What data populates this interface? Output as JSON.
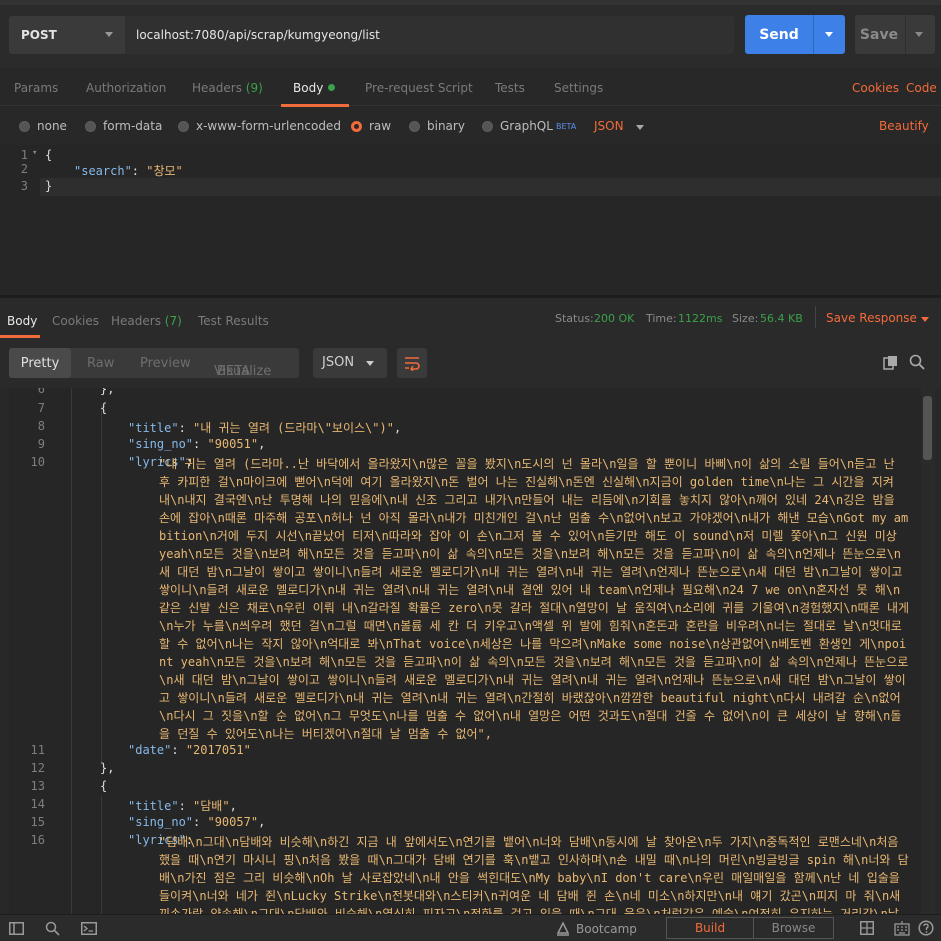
{
  "request": {
    "method": "POST",
    "url": "localhost:7080/api/scrap/kumgyeong/list",
    "send_label": "Send",
    "save_label": "Save"
  },
  "request_tabs": {
    "params": "Params",
    "authorization": "Authorization",
    "headers": "Headers",
    "headers_count": "(9)",
    "body": "Body",
    "pre_request": "Pre-request Script",
    "tests": "Tests",
    "settings": "Settings",
    "cookies": "Cookies",
    "code": "Code"
  },
  "body_options": {
    "none": "none",
    "form_data": "form-data",
    "urlencoded": "x-www-form-urlencoded",
    "raw": "raw",
    "binary": "binary",
    "graphql": "GraphQL",
    "beta": "BETA",
    "format": "JSON",
    "beautify": "Beautify"
  },
  "request_body": {
    "line_numbers": [
      "1",
      "2",
      "3"
    ],
    "open": "{",
    "key": "\"search\"",
    "colon": ": ",
    "value": "\"창모\"",
    "close": "}"
  },
  "response_tabs": {
    "body": "Body",
    "cookies": "Cookies",
    "headers": "Headers",
    "headers_count": "(7)",
    "test_results": "Test Results",
    "status_label": "Status:",
    "status_value": "200 OK",
    "time_label": "Time:",
    "time_value": "1122ms",
    "size_label": "Size:",
    "size_value": "56.4 KB",
    "save_response": "Save Response"
  },
  "view_bar": {
    "pretty": "Pretty",
    "raw": "Raw",
    "preview": "Preview",
    "visualize": "Visualize",
    "beta": "BETA",
    "format": "JSON"
  },
  "response": {
    "ln": [
      "6",
      "7",
      "8",
      "9",
      "10",
      "11",
      "12",
      "13",
      "14",
      "15",
      "16"
    ],
    "line6": "},",
    "line7": "{",
    "title1_key": "\"title\"",
    "title1_val": "\"내 귀는 열려 (드라마\\\"보이스\\\")\"",
    "sing1_key": "\"sing_no\"",
    "sing1_val": "\"90051\"",
    "lyrics_key": "\"lyrics\"",
    "lyrics1": "\"내 귀는 열려 (드라마..난 바닥에서 올라왔지\\n많은 꼴을 봤지\\n도시의 넌 몰라\\n일을 할 뿐이니 바삐\\n이 삶의 소릴 들어\\n듣고 난 후 카피한 걸\\n마이크에 뻗어\\n덕에 여기 올라왔지\\n돈 벌어 나는 진실해\\n돈엔 신실해\\n지금이 golden time\\n나는 그 시간을 지켜 내\\n내지 결국엔\\n난 투명해 나의 믿음에\\n내 신조 그리고 내가\\n만들어 내는 리듬에\\n기회를 놓치지 않아\\n깨어 있네 24\\n깅은 밤을 손에 잡아\\n때론 마주해 공포\\n허나 넌 아직 몰라\\n내가 미친개인 걸\\n난 멈출 수\\n없어\\n보고 가야겠어\\n내가 해낸 모습\\nGot my ambition\\n거에 두지 시선\\n끝났어 티저\\n따라와 잡아 이 손\\n그저 볼 수 있어\\n듣기만 해도 이 sound\\n저 미렐 쫓아\\n그 신원 미상 yeah\\n모든 것을\\n보려 해\\n모든 것을 듣고파\\n이 삶 속의\\n모든 것을\\n보려 해\\n모든 것을 듣고파\\n이 삶 속의\\n언제나 뜬눈으로\\n새 대던 밤\\n그날이 쌓이고 쌓이니\\n들려 새로운 멜로디가\\n내 귀는 열려\\n내 귀는 열려\\n언제나 뜬눈으로\\n새 대던 밤\\n그날이 쌓이고 쌓이니\\n들려 새로운 멜로디가\\n내 귀는 열려\\n내 귀는 열려\\n내 곁엔 있어 내 team\\n언제나 필요해\\n24 7 we on\\n혼자선 못 해\\n같은 신발 신은 채로\\n우린 이뤄 내\\n갈라질 확률은 zero\\n못 갈라 절대\\n열망이 날 움직여\\n소리에 귀를 기울여\\n경험했지\\n때론 내게\\n누가 누를\\n씌우려 했던 걸\\n그럴 때면\\n볼륨 세 칸 더 키우고\\n액셀 위 발에 힘줘\\n혼돈과 혼란을 비우려\\n너는 절대로 날\\n멋대로 할 수 없어\\n나는 작지 않아\\n억대로 봐\\nThat voice\\n세상은 나를 막으려\\nMake some noise\\n상관없어\\n베토벤 환생인 게\\npoint yeah\\n모든 것을\\n보려 해\\n모든 것을 듣고파\\n이 삶 속의\\n모든 것을\\n보려 해\\n모든 것을 듣고파\\n이 삶 속의\\n언제나 뜬눈으로\\n새 대던 밤\\n그날이 쌓이고 쌓이니\\n들려 새로운 멜로디가\\n내 귀는 열려\\n내 귀는 열려\\n언제나 뜬눈으로\\n새 대던 밤\\n그날이 쌓이고 쌓이니\\n들려 새로운 멜로디가\\n내 귀는 열려\\n내 귀는 열려\\n간절히 바랬잖아\\n깜깜한 beautiful night\\n다시 내려갈 순\\n없어\\n다시 그 짓을\\n할 순 없어\\n그 무엇도\\n나를 멈출 수 없어\\n내 열망은 어떤 것과도\\n절대 건줄 수 없어\\n이 큰 세상이 날 향해\\n돌을 던질 수 있어도\\n나는 버티겠어\\n절대 날 멈출 수 없어\",",
    "date_key": "\"date\"",
    "date1_val": "\"2017051\"",
    "line12": "},",
    "line13": "{",
    "title2_val": "\"담배\"",
    "sing2_val": "\"90057\"",
    "lyrics2": "\"담배\\n그대\\n담배와 비슷해\\n하긴 지금 내 앞에서도\\n연기를 뱉어\\n너와 담배\\n동시에 날 찾아온\\n두 가지\\n중독적인 로맨스네\\n처음 했을 때\\n연기 마시니 핑\\n처음 봤을 때\\n그대가 담배 연기를 훅\\n뱉고 인사하며\\n손 내밀 때\\n나의 머린\\n빙글빙글 spin 해\\n너와 담배\\n가진 점은 그리 비슷해\\nOh 날 사로잡았네\\n내 안을 썩힌대도\\nMy baby\\nI don't care\\n우린 매일매일을 함께\\n난 네 입술을 들이켜\\n너와 네가 쥔\\nLucky Strike\\n전봇대와\\n스티커\\n귀여운 네 담배 쥔 손\\n네 미소\\n하지만\\n내 얘기 갔곤\\n피지 마 줘\\n새끼손가락 약속해\\n그대\\n담배와 비슷해\\n옆신히 피자고\\n전화를 걸고 있을 때\\n그대 웃음\\n처럼같은 예술\\n여전히 유지하는 거리감\\n날"
  },
  "status_bar": {
    "bootcamp": "Bootcamp",
    "build": "Build",
    "browse": "Browse"
  }
}
